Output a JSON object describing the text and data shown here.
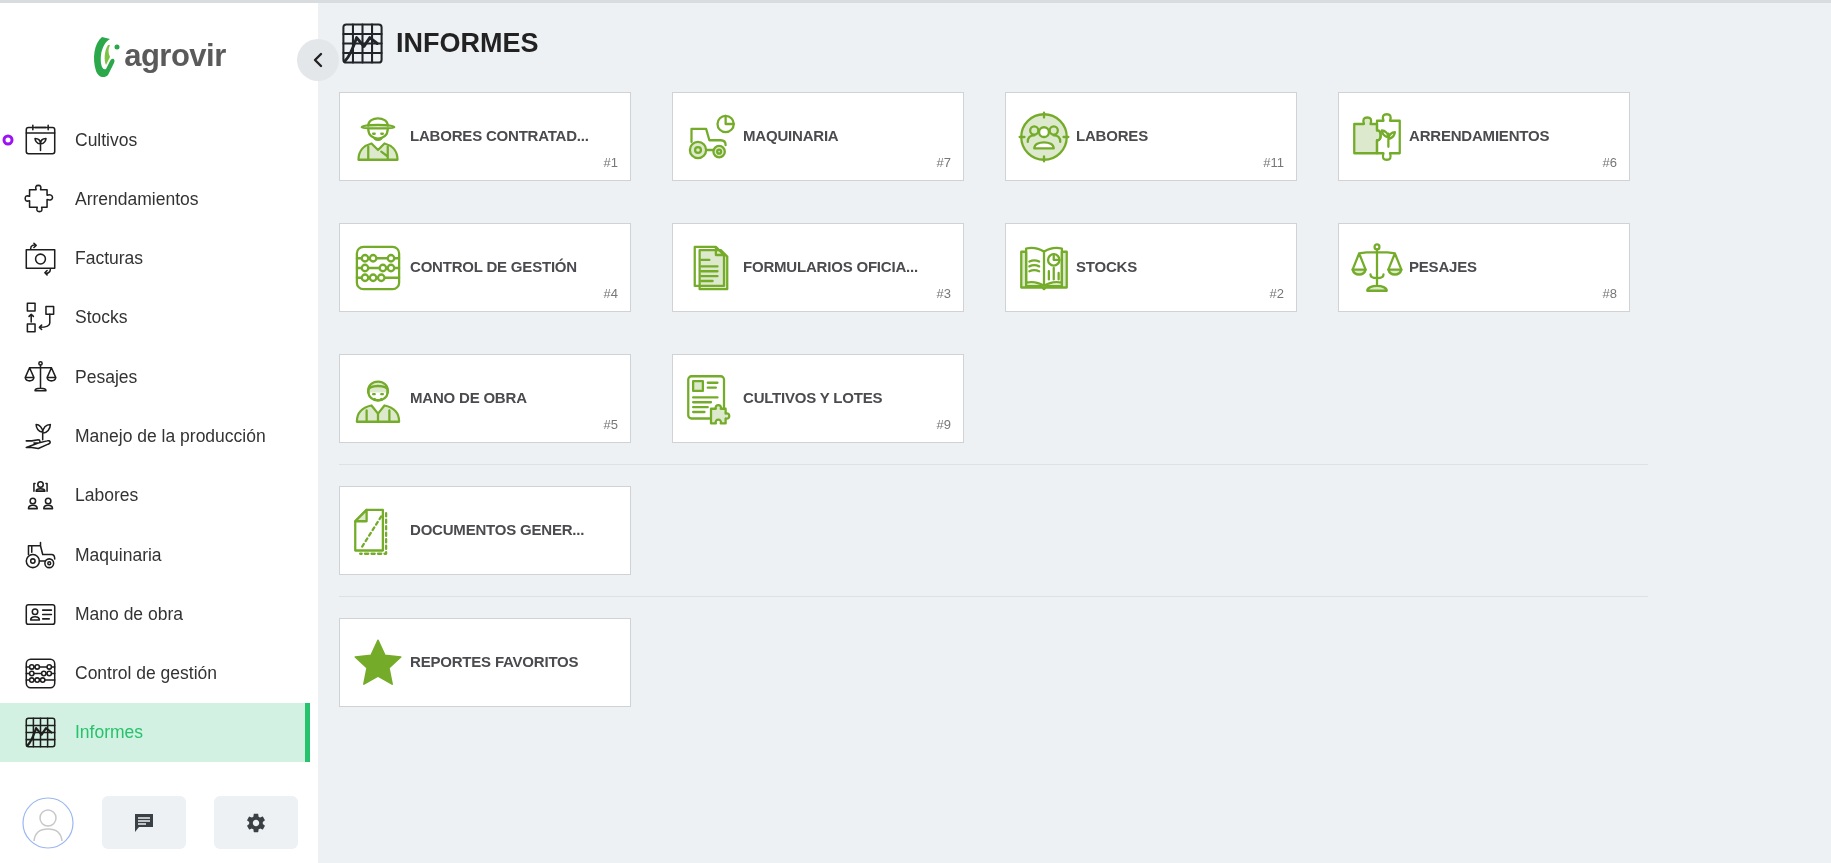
{
  "logo": {
    "text": "agrovir"
  },
  "sidebar": {
    "items": [
      {
        "label": "Cultivos",
        "selected": false
      },
      {
        "label": "Arrendamientos",
        "selected": false
      },
      {
        "label": "Facturas",
        "selected": false
      },
      {
        "label": "Stocks",
        "selected": false
      },
      {
        "label": "Pesajes",
        "selected": false
      },
      {
        "label": "Manejo de la producción",
        "selected": false
      },
      {
        "label": "Labores",
        "selected": false
      },
      {
        "label": "Maquinaria",
        "selected": false
      },
      {
        "label": "Mano de obra",
        "selected": false
      },
      {
        "label": "Control de gestión",
        "selected": false
      },
      {
        "label": "Informes",
        "selected": true
      }
    ]
  },
  "page_title": "INFORMES",
  "report_groups": [
    {
      "cards": [
        {
          "title": "LABORES CONTRATAD...",
          "number": "#1"
        },
        {
          "title": "MAQUINARIA",
          "number": "#7"
        },
        {
          "title": "LABORES",
          "number": "#11"
        },
        {
          "title": "ARRENDAMIENTOS",
          "number": "#6"
        },
        {
          "title": "CONTROL DE GESTIÓN",
          "number": "#4"
        },
        {
          "title": "FORMULARIOS OFICIA...",
          "number": "#3"
        },
        {
          "title": "STOCKS",
          "number": "#2"
        },
        {
          "title": "PESAJES",
          "number": "#8"
        },
        {
          "title": "MANO DE OBRA",
          "number": "#5"
        },
        {
          "title": "CULTIVOS Y LOTES",
          "number": "#9"
        }
      ]
    },
    {
      "cards": [
        {
          "title": "DOCUMENTOS GENER..."
        }
      ]
    },
    {
      "cards": [
        {
          "title": "REPORTES FAVORITOS"
        }
      ]
    }
  ]
}
